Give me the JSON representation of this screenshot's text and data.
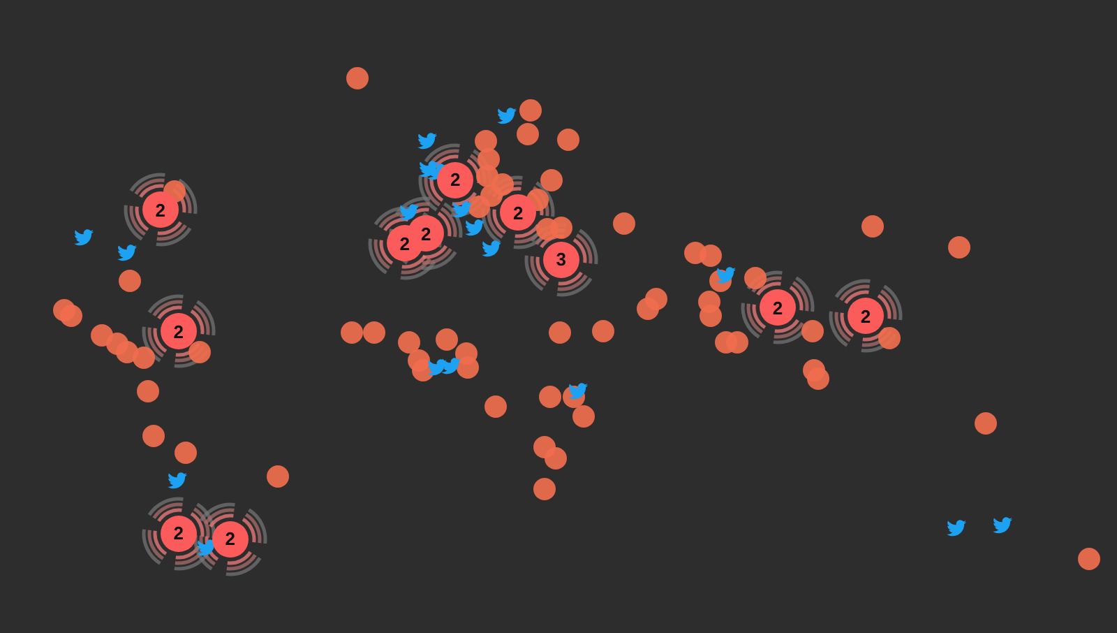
{
  "map": {
    "markers": [
      {
        "kind": "point"
      },
      {
        "kind": "point"
      },
      {
        "kind": "point"
      },
      {
        "kind": "point"
      },
      {
        "kind": "point"
      },
      {
        "kind": "point"
      },
      {
        "kind": "point"
      },
      {
        "kind": "point"
      },
      {
        "kind": "point"
      },
      {
        "kind": "point"
      },
      {
        "kind": "point"
      },
      {
        "kind": "point"
      },
      {
        "kind": "point"
      },
      {
        "kind": "point"
      },
      {
        "kind": "point"
      },
      {
        "kind": "point"
      },
      {
        "kind": "point"
      },
      {
        "kind": "point"
      },
      {
        "kind": "point"
      },
      {
        "kind": "point"
      },
      {
        "kind": "point"
      },
      {
        "kind": "point"
      },
      {
        "kind": "point"
      },
      {
        "kind": "point"
      },
      {
        "kind": "point"
      },
      {
        "kind": "point"
      },
      {
        "kind": "point"
      },
      {
        "kind": "point"
      },
      {
        "kind": "point"
      },
      {
        "kind": "point"
      },
      {
        "kind": "point"
      },
      {
        "kind": "point"
      },
      {
        "kind": "point"
      },
      {
        "kind": "point"
      },
      {
        "kind": "point"
      },
      {
        "kind": "point"
      },
      {
        "kind": "point"
      },
      {
        "kind": "point"
      },
      {
        "kind": "point"
      },
      {
        "kind": "point"
      },
      {
        "kind": "point"
      },
      {
        "kind": "point"
      },
      {
        "kind": "point"
      },
      {
        "kind": "point"
      },
      {
        "kind": "point"
      },
      {
        "kind": "point"
      },
      {
        "kind": "point"
      },
      {
        "kind": "point"
      },
      {
        "kind": "point"
      },
      {
        "kind": "point"
      },
      {
        "kind": "point"
      },
      {
        "kind": "point"
      },
      {
        "kind": "point"
      },
      {
        "kind": "point"
      },
      {
        "kind": "point"
      },
      {
        "kind": "point"
      },
      {
        "kind": "point"
      },
      {
        "kind": "point"
      },
      {
        "kind": "point"
      },
      {
        "kind": "point"
      },
      {
        "kind": "point"
      },
      {
        "kind": "point"
      },
      {
        "kind": "point"
      },
      {
        "kind": "tweet"
      },
      {
        "kind": "tweet"
      },
      {
        "kind": "tweet"
      },
      {
        "kind": "tweet"
      },
      {
        "kind": "tweet"
      },
      {
        "kind": "tweet"
      },
      {
        "kind": "tweet"
      },
      {
        "kind": "tweet"
      },
      {
        "kind": "tweet"
      },
      {
        "kind": "tweet"
      },
      {
        "kind": "tweet"
      },
      {
        "kind": "tweet"
      },
      {
        "kind": "tweet"
      },
      {
        "kind": "tweet"
      },
      {
        "kind": "tweet"
      },
      {
        "kind": "tweet"
      },
      {
        "kind": "tweet"
      },
      {
        "kind": "tweet"
      },
      {
        "kind": "cluster",
        "count": "2"
      },
      {
        "kind": "cluster",
        "count": "2"
      },
      {
        "kind": "cluster",
        "count": "2"
      },
      {
        "kind": "cluster",
        "count": "2"
      },
      {
        "kind": "cluster",
        "count": "2"
      },
      {
        "kind": "cluster",
        "count": "2"
      },
      {
        "kind": "cluster",
        "count": "3"
      },
      {
        "kind": "cluster",
        "count": "2"
      },
      {
        "kind": "cluster",
        "count": "2"
      },
      {
        "kind": "cluster",
        "count": "2"
      },
      {
        "kind": "cluster",
        "count": "2"
      }
    ]
  }
}
